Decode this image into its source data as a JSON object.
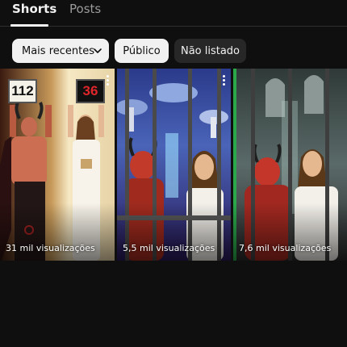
{
  "tabs": [
    {
      "label": "Shorts",
      "active": true
    },
    {
      "label": "Posts",
      "active": false
    }
  ],
  "filters": {
    "sort_label": "Mais recentes",
    "chips": [
      "Público",
      "Não listado"
    ]
  },
  "shorts": [
    {
      "views": "31 mil visualizações",
      "sign_left": "112",
      "sign_right": "36"
    },
    {
      "views": "5,5 mil visualizações"
    },
    {
      "views": "7,6 mil visualizações"
    }
  ],
  "colors": {
    "background": "#0f0f0f",
    "chip_light": "#f1f1f1",
    "chip_dark": "#272727",
    "sign_red": "#e0262a"
  },
  "icons": {
    "sort_chevron": "chevron-down-icon",
    "card_menu": "more-vert-icon"
  }
}
